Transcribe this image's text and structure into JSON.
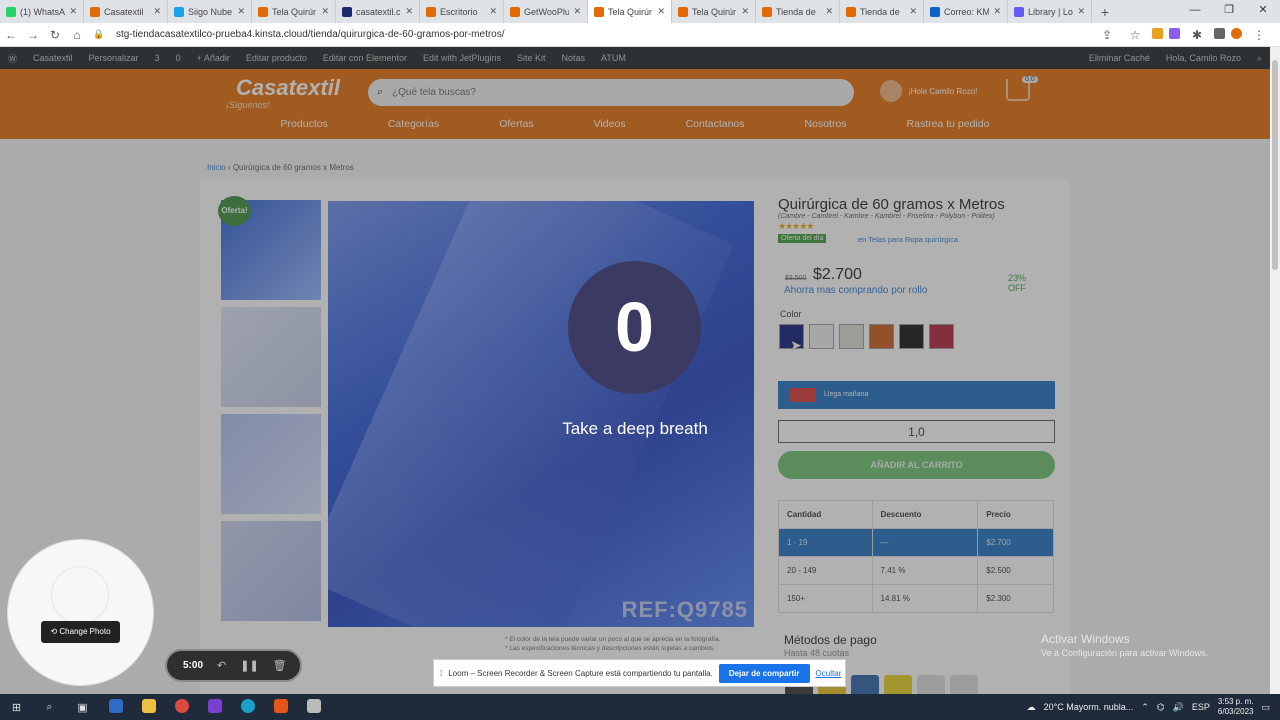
{
  "browser": {
    "tabs": [
      {
        "label": "(1) WhatsAp",
        "color": "#25d366"
      },
      {
        "label": "Casatextil",
        "color": "#e36a05"
      },
      {
        "label": "Siigo Nube",
        "color": "#1aa3e8"
      },
      {
        "label": "Tela Quirúr",
        "color": "#e36a05"
      },
      {
        "label": "casatextil.c",
        "color": "#1d2b6b"
      },
      {
        "label": "Escritorio",
        "color": "#e36a05"
      },
      {
        "label": "GetWooPlu",
        "color": "#e36a05"
      },
      {
        "label": "Tela Quirúr",
        "color": "#e36a05",
        "active": true
      },
      {
        "label": "Tela Quirúr",
        "color": "#e36a05"
      },
      {
        "label": "Tienda de",
        "color": "#e36a05"
      },
      {
        "label": "Tienda de",
        "color": "#e36a05"
      },
      {
        "label": "Correo: KM",
        "color": "#0a64c8"
      },
      {
        "label": "Library | Lo",
        "color": "#625df5"
      }
    ],
    "new_tab": "+",
    "url": "stg-tiendacasatextilco-prueba4.kinsta.cloud/tienda/quirurgica-de-60-gramos-por-metros/"
  },
  "wpbar": {
    "items": [
      "Casatextil",
      "Personalizar",
      "3",
      "0",
      "+ Añadir",
      "Editar producto",
      "Editar con Elementor",
      "Edit with JetPlugins",
      "Site Kit",
      "Notas",
      "ATUM"
    ],
    "right": [
      "Eliminar Caché",
      "Hola, Camilo Rozo"
    ]
  },
  "header": {
    "logo": "Casatextil",
    "siguenos": "¡Síguenos!",
    "search_placeholder": "¿Qué tela buscas?",
    "greeting": "¡Hola Camilo Rozo!",
    "cart_count": "0.0",
    "menu": [
      "Productos",
      "Categorías",
      "Ofertas",
      "Videos",
      "Contactanos",
      "Nosotros",
      "Rastrea tu pedido"
    ]
  },
  "breadcrumb": {
    "home": "Inicio",
    "sep": "›",
    "current": "Quirúrgica de 60 gramos x Metros"
  },
  "gallery": {
    "badge": "Oferta!",
    "ref": "REF:Q9785",
    "note1": "* El color de la tela puede variar un poco al que se aprecia en la fotografía.",
    "note2": "* Las especificaciones técnicas y descripciones están sujetas a cambios."
  },
  "product": {
    "title": "Quirúrgica de 60 gramos x Metros",
    "subtitle": "(Cambre - Cambrel - Kambre - Kambrel - Friselina - Polybon - Politex)",
    "stars": "★★★★★",
    "deal": "Oferta del día",
    "category": "en Telas para Ropa quirúrgica",
    "old_price": "$3.500",
    "price": "$2.700",
    "discount": "23%",
    "discount_label": "OFF",
    "roll_link": "Ahorra mas comprando por rollo",
    "color_label": "Color",
    "swatches": [
      "#0a1a78",
      "#eeeeee",
      "#d9dfd2",
      "#c85a1a",
      "#111111",
      "#b0203a"
    ],
    "shipping": "Llega mañana",
    "qty": "1,0",
    "add_to_cart": "AÑADIR AL CARRITO",
    "table_headers": [
      "Cantidad",
      "Descuento",
      "Precio"
    ],
    "table_rows": [
      [
        "1 - 19",
        "—",
        "$2.700"
      ],
      [
        "20 - 149",
        "7.41 %",
        "$2.500"
      ],
      [
        "150+",
        "14.81 %",
        "$2.300"
      ]
    ],
    "payment_title": "Métodos de pago",
    "payment_sub": "Hasta 48 cuotas",
    "payment_colors": [
      "#333333",
      "#e8c020",
      "#2a5fa8",
      "#e8d020",
      "#dcdcdc",
      "#dcdcdc"
    ]
  },
  "overlay": {
    "countdown": "0",
    "message": "Take a deep breath"
  },
  "loom": {
    "change_photo": "Change Photo",
    "timer": "5:00",
    "share_text": "Loom – Screen Recorder & Screen Capture está compartiendo tu pantalla.",
    "stop_share": "Dejar de compartir",
    "hide": "Ocultar"
  },
  "windows": {
    "activate_title": "Activar Windows",
    "activate_sub": "Ve a Configuración para activar Windows.",
    "weather": "20°C  Mayorm. nubla...",
    "lang": "ESP",
    "time": "3:53 p. m.",
    "date": "6/03/2023"
  }
}
